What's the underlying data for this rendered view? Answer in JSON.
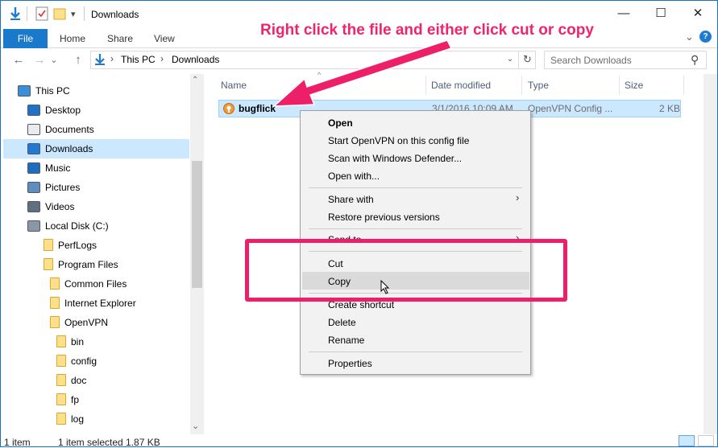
{
  "window": {
    "title": "Downloads",
    "minimize_glyph": "—",
    "maximize_glyph": "☐",
    "close_glyph": "✕"
  },
  "quick_access": {
    "dropdown_glyph": "▾"
  },
  "ribbon": {
    "tabs": [
      "File",
      "Home",
      "Share",
      "View"
    ],
    "collapse_glyph": "⌄",
    "help_glyph": "?"
  },
  "address": {
    "path": [
      "This PC",
      "Downloads"
    ],
    "separator": "›",
    "refresh_glyph": "↻",
    "dropdown_glyph": "⌄",
    "search_placeholder": "Search Downloads",
    "search_icon": "⚲"
  },
  "nav_buttons": {
    "back": "←",
    "forward": "→",
    "recent": "⌄",
    "up": "↑"
  },
  "nav_pane": {
    "items": [
      {
        "label": "This PC",
        "icon": "pc-icon",
        "level": 0
      },
      {
        "label": "Desktop",
        "icon": "desktop-icon",
        "level": 1
      },
      {
        "label": "Documents",
        "icon": "documents-icon",
        "level": 1
      },
      {
        "label": "Downloads",
        "icon": "downloads-icon",
        "level": 1,
        "selected": true
      },
      {
        "label": "Music",
        "icon": "music-icon",
        "level": 1
      },
      {
        "label": "Pictures",
        "icon": "pictures-icon",
        "level": 1
      },
      {
        "label": "Videos",
        "icon": "videos-icon",
        "level": 1
      },
      {
        "label": "Local Disk (C:)",
        "icon": "disk-icon",
        "level": 1
      },
      {
        "label": "PerfLogs",
        "icon": "folder-icon",
        "level": 2
      },
      {
        "label": "Program Files",
        "icon": "folder-icon",
        "level": 2
      },
      {
        "label": "Common Files",
        "icon": "folder-icon",
        "level": 3
      },
      {
        "label": "Internet Explorer",
        "icon": "folder-icon",
        "level": 3
      },
      {
        "label": "OpenVPN",
        "icon": "folder-icon",
        "level": 3
      },
      {
        "label": "bin",
        "icon": "folder-icon",
        "level": 4
      },
      {
        "label": "config",
        "icon": "folder-icon",
        "level": 4
      },
      {
        "label": "doc",
        "icon": "folder-icon",
        "level": 4
      },
      {
        "label": "fp",
        "icon": "folder-icon",
        "level": 4
      },
      {
        "label": "log",
        "icon": "folder-icon",
        "level": 4
      }
    ],
    "scroll_up": "⌃",
    "scroll_down": "⌄"
  },
  "columns": {
    "name": "Name",
    "date_modified": "Date modified",
    "type": "Type",
    "size": "Size",
    "sort_glyph": "^"
  },
  "file": {
    "name": "bugflick",
    "date_modified": "3/1/2016 10:09 AM",
    "type": "OpenVPN Config ...",
    "size": "2 KB"
  },
  "context_menu": {
    "open": "Open",
    "start_openvpn": "Start OpenVPN on this config file",
    "scan": "Scan with Windows Defender...",
    "open_with": "Open with...",
    "share_with": "Share with",
    "restore": "Restore previous versions",
    "send_to": "Send to",
    "cut": "Cut",
    "copy": "Copy",
    "create_shortcut": "Create shortcut",
    "delete": "Delete",
    "rename": "Rename",
    "properties": "Properties",
    "submenu_glyph": "›"
  },
  "status": {
    "item_count": "1 item",
    "selection": "1 item selected  1.87 KB"
  },
  "annotation": {
    "text": "Right click the file and either click cut or copy",
    "color": "#ee1f69"
  }
}
